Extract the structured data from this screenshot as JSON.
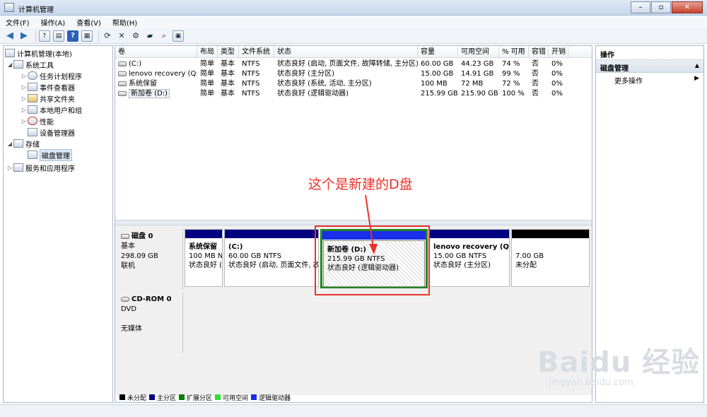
{
  "window": {
    "title": "计算机管理"
  },
  "window_buttons": {
    "minimize": "–",
    "restore": "▫",
    "close": "✕"
  },
  "menu": [
    "文件(F)",
    "操作(A)",
    "查看(V)",
    "帮助(H)"
  ],
  "toolbar_icons": [
    "back-arrow-icon",
    "forward-arrow-icon",
    "folder-up-icon",
    "show-tree-icon",
    "help-icon",
    "properties-icon",
    "refresh-icon",
    "delete-icon",
    "settings-icon",
    "open-folder-icon",
    "search-icon",
    "properties-sheet-icon"
  ],
  "tree": {
    "root": "计算机管理(本地)",
    "system_tools": "系统工具",
    "task_scheduler": "任务计划程序",
    "event_viewer": "事件查看器",
    "shared_folders": "共享文件夹",
    "local_users": "本地用户和组",
    "performance": "性能",
    "device_manager": "设备管理器",
    "storage": "存储",
    "disk_management": "磁盘管理",
    "services_apps": "服务和应用程序"
  },
  "volume_table": {
    "headers": [
      "卷",
      "布局",
      "类型",
      "文件系统",
      "状态",
      "容量",
      "可用空间",
      "% 可用",
      "容错",
      "开销"
    ],
    "rows": [
      [
        "(C:)",
        "简单",
        "基本",
        "NTFS",
        "状态良好 (启动, 页面文件, 故障转储, 主分区)",
        "60.00 GB",
        "44.23 GB",
        "74 %",
        "否",
        "0%"
      ],
      [
        "lenovo recovery (Q:)",
        "简单",
        "基本",
        "NTFS",
        "状态良好 (主分区)",
        "15.00 GB",
        "14.91 GB",
        "99 %",
        "否",
        "0%"
      ],
      [
        "系统保留",
        "简单",
        "基本",
        "NTFS",
        "状态良好 (系统, 活动, 主分区)",
        "100 MB",
        "72 MB",
        "72 %",
        "否",
        "0%"
      ],
      [
        "新加卷 (D:)",
        "简单",
        "基本",
        "NTFS",
        "状态良好 (逻辑驱动器)",
        "215.99 GB",
        "215.90 GB",
        "100 %",
        "否",
        "0%"
      ]
    ]
  },
  "disk0": {
    "name": "磁盘 0",
    "type": "基本",
    "size": "298.09 GB",
    "status": "联机"
  },
  "partitions": {
    "sysres": {
      "name": "系统保留",
      "size": "100 MB N",
      "status": "状态良好 ("
    },
    "c": {
      "name": "(C:)",
      "size": "60.00 GB NTFS",
      "status": "状态良好 (启动, 页面文件, 故"
    },
    "d": {
      "name": "新加卷 (D:)",
      "size": "215.99 GB NTFS",
      "status": "状态良好 (逻辑驱动器)"
    },
    "q": {
      "name": "lenovo recovery (Q:)",
      "size": "15.00 GB NTFS",
      "status": "状态良好 (主分区)"
    },
    "unalloc": {
      "size": "7.00 GB",
      "status": "未分配"
    }
  },
  "cdrom0": {
    "name": "CD-ROM 0",
    "type": "DVD",
    "media": "无媒体"
  },
  "legend": [
    "未分配",
    "主分区",
    "扩展分区",
    "可用空间",
    "逻辑驱动器"
  ],
  "colors": {
    "unallocated": "#000000",
    "primary": "#000080",
    "extended": "#008000",
    "free_space": "#33dd33",
    "logical": "#1a2de8",
    "annotation": "#e8332b"
  },
  "actions": {
    "header": "操作",
    "section": "磁盘管理",
    "more": "更多操作"
  },
  "annotation": {
    "text": "这个是新建的D盘"
  },
  "watermark": {
    "main": "Baidu 经验",
    "url": "jingyan.baidu.com"
  }
}
